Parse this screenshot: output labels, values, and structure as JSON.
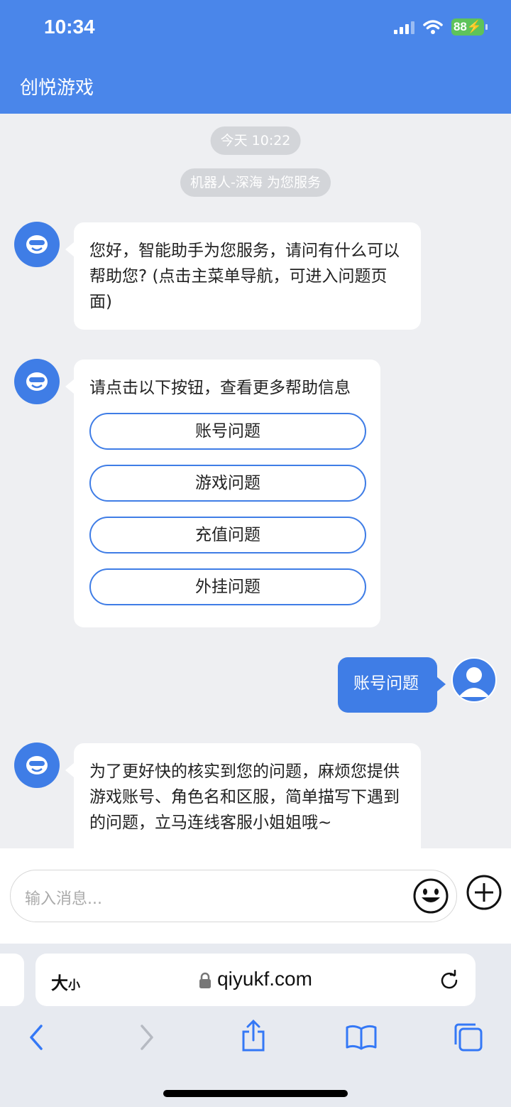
{
  "status_bar": {
    "time": "10:34",
    "battery": "88"
  },
  "header": {
    "title": "创悦游戏"
  },
  "chat": {
    "date_pill": "今天 10:22",
    "service_pill": "机器人-深海 为您服务",
    "bot_msg_1": "您好，智能助手为您服务，请问有什么可以帮助您? (点击主菜单导航，可进入问题页面)",
    "bot_msg_2": "请点击以下按钮，查看更多帮助信息",
    "options": [
      "账号问题",
      "游戏问题",
      "充值问题",
      "外挂问题"
    ],
    "user_msg": "账号问题",
    "bot_msg_3": "为了更好快的核实到您的问题，麻烦您提供游戏账号、角色名和区服，简单描写下遇到的问题，立马连线客服小姐姐哦~"
  },
  "input": {
    "placeholder": "输入消息..."
  },
  "browser": {
    "text_size_label_big": "大",
    "text_size_label_small": "小",
    "url": "qiyukf.com"
  },
  "colors": {
    "accent": "#3f7de6",
    "header": "#4a86ea",
    "chat_bg": "#eeeff2"
  },
  "icons": [
    "robot-icon",
    "user-icon",
    "emoji-icon",
    "plus-icon",
    "lock-icon",
    "reload-icon",
    "back-icon",
    "forward-icon",
    "share-icon",
    "bookmarks-icon",
    "tabs-icon"
  ]
}
